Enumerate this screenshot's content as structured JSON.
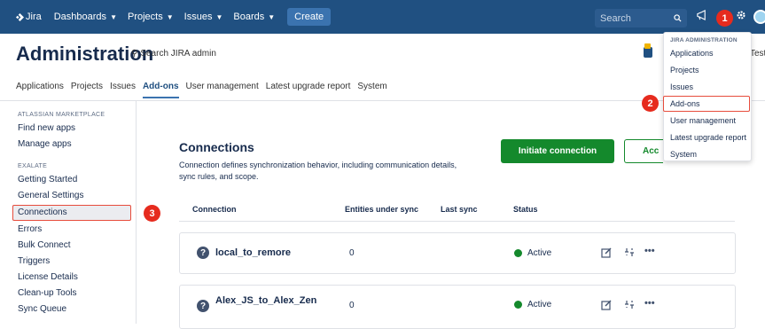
{
  "topnav": {
    "logo_text": "Jira",
    "items": [
      {
        "label": "Dashboards"
      },
      {
        "label": "Projects"
      },
      {
        "label": "Issues"
      },
      {
        "label": "Boards"
      }
    ],
    "create_label": "Create",
    "search_placeholder": "Search"
  },
  "header": {
    "title": "Administration",
    "search_link": "Search JIRA admin",
    "user_partial": "Test"
  },
  "tabs": [
    {
      "label": "Applications",
      "active": false
    },
    {
      "label": "Projects",
      "active": false
    },
    {
      "label": "Issues",
      "active": false
    },
    {
      "label": "Add-ons",
      "active": true
    },
    {
      "label": "User management",
      "active": false
    },
    {
      "label": "Latest upgrade report",
      "active": false
    },
    {
      "label": "System",
      "active": false
    }
  ],
  "sidebar": {
    "marketplace_heading": "ATLASSIAN MARKETPLACE",
    "marketplace_items": [
      {
        "label": "Find new apps"
      },
      {
        "label": "Manage apps"
      }
    ],
    "exalate_heading": "EXALATE",
    "exalate_items": [
      {
        "label": "Getting Started"
      },
      {
        "label": "General Settings"
      },
      {
        "label": "Connections"
      },
      {
        "label": "Errors"
      },
      {
        "label": "Bulk Connect"
      },
      {
        "label": "Triggers"
      },
      {
        "label": "License Details"
      },
      {
        "label": "Clean-up Tools"
      },
      {
        "label": "Sync Queue"
      }
    ]
  },
  "main": {
    "title": "Connections",
    "description": "Connection defines synchronization behavior, including communication details, sync rules, and scope.",
    "initiate_label": "Initiate connection",
    "accept_label_partial": "Acc",
    "columns": {
      "connection": "Connection",
      "entities": "Entities under sync",
      "last_sync": "Last sync",
      "status": "Status"
    },
    "rows": [
      {
        "name": "local_to_remore",
        "entities": "0",
        "status": "Active"
      },
      {
        "name": "Alex_JS_to_Alex_Zen",
        "entities": "0",
        "status": "Active"
      }
    ]
  },
  "dropdown": {
    "heading": "JIRA ADMINISTRATION",
    "items": [
      {
        "label": "Applications"
      },
      {
        "label": "Projects"
      },
      {
        "label": "Issues"
      },
      {
        "label": "Add-ons"
      },
      {
        "label": "User management"
      },
      {
        "label": "Latest upgrade report"
      },
      {
        "label": "System"
      }
    ]
  },
  "callouts": [
    "1",
    "2",
    "3"
  ],
  "colors": {
    "nav_bg": "#205081",
    "primary_button": "#14892c",
    "callout": "#e62b1e",
    "status_active": "#14892c"
  }
}
